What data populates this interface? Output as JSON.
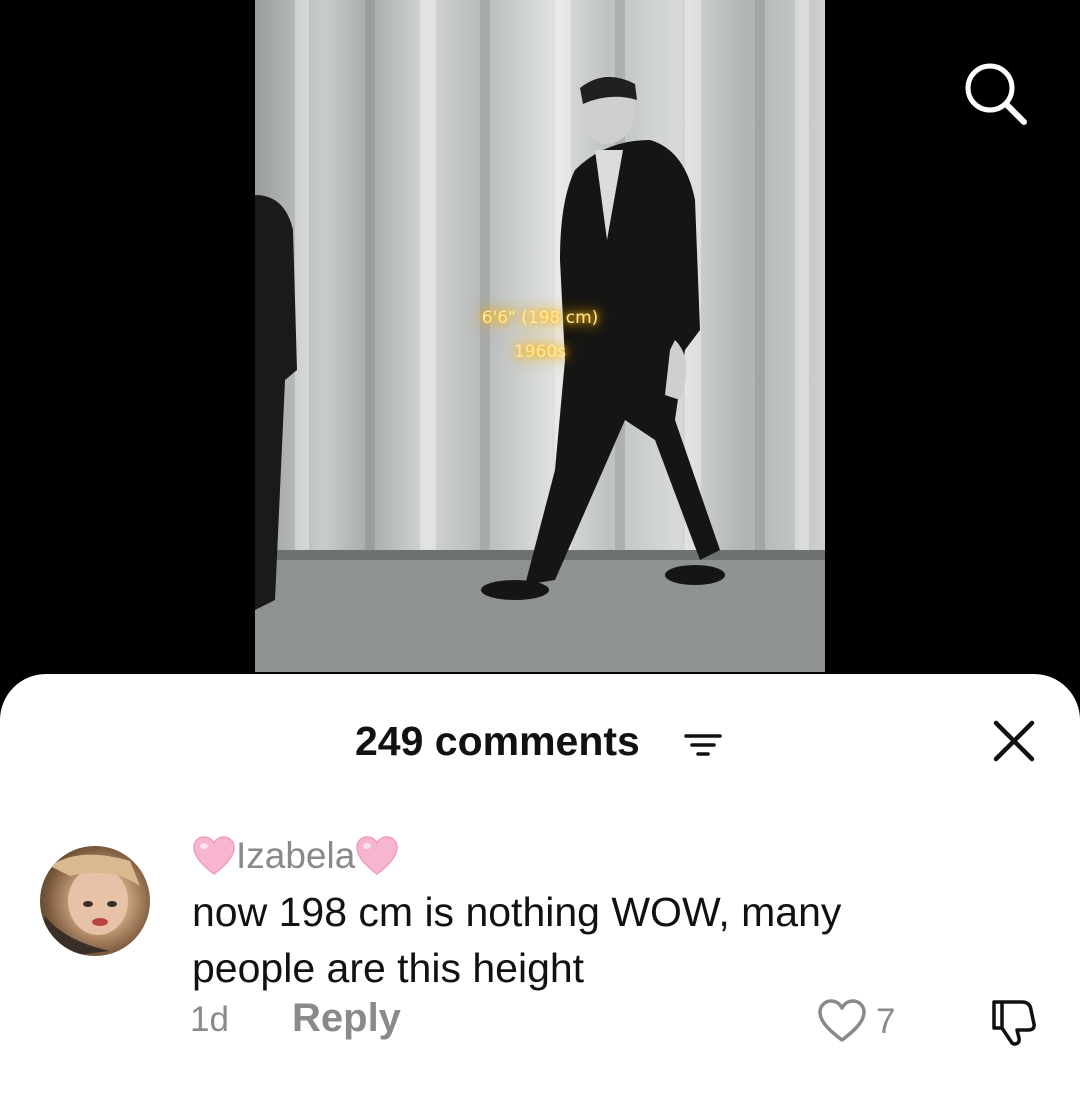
{
  "video": {
    "overlay_line1": "6'6\" (198 cm)",
    "overlay_line2": "1960s"
  },
  "header": {
    "search_icon": "search-icon"
  },
  "comments_sheet": {
    "title": "249 comments",
    "sort_icon": "filter-sort-icon",
    "close_icon": "close-icon"
  },
  "comment": {
    "username": "Izabela",
    "username_decoration": "pink-heart-emoji",
    "text": "now 198 cm is nothing WOW, many people are this height",
    "time": "1d",
    "reply_label": "Reply",
    "like_count": "7",
    "like_icon": "heart-outline-icon",
    "dislike_icon": "thumbs-down-icon"
  }
}
